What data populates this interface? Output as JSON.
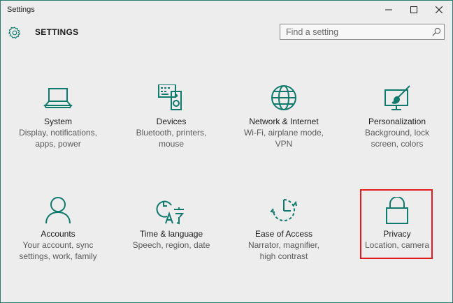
{
  "window": {
    "title": "Settings",
    "controls": [
      "minimize",
      "maximize",
      "close"
    ]
  },
  "header": {
    "icon": "gear-icon",
    "title": "SETTINGS",
    "search_placeholder": "Find a setting"
  },
  "accent_color": "#0f7a6c",
  "highlight_color": "#e01d1d",
  "categories": [
    {
      "name": "System",
      "desc_line1": "Display, notifications,",
      "desc_line2": "apps, power",
      "icon": "laptop-icon"
    },
    {
      "name": "Devices",
      "desc_line1": "Bluetooth, printers,",
      "desc_line2": "mouse",
      "icon": "keyboard-speaker-icon"
    },
    {
      "name": "Network & Internet",
      "desc_line1": "Wi-Fi, airplane mode,",
      "desc_line2": "VPN",
      "icon": "globe-icon"
    },
    {
      "name": "Personalization",
      "desc_line1": "Background, lock",
      "desc_line2": "screen, colors",
      "icon": "paint-brush-icon"
    },
    {
      "name": "Accounts",
      "desc_line1": "Your account, sync",
      "desc_line2": "settings, work, family",
      "icon": "person-icon"
    },
    {
      "name": "Time & language",
      "desc_line1": "Speech, region, date",
      "desc_line2": "",
      "icon": "clock-language-icon"
    },
    {
      "name": "Ease of Access",
      "desc_line1": "Narrator, magnifier,",
      "desc_line2": "high contrast",
      "icon": "ease-of-access-icon"
    },
    {
      "name": "Privacy",
      "desc_line1": "Location, camera",
      "desc_line2": "",
      "icon": "lock-icon",
      "highlighted": true
    }
  ]
}
